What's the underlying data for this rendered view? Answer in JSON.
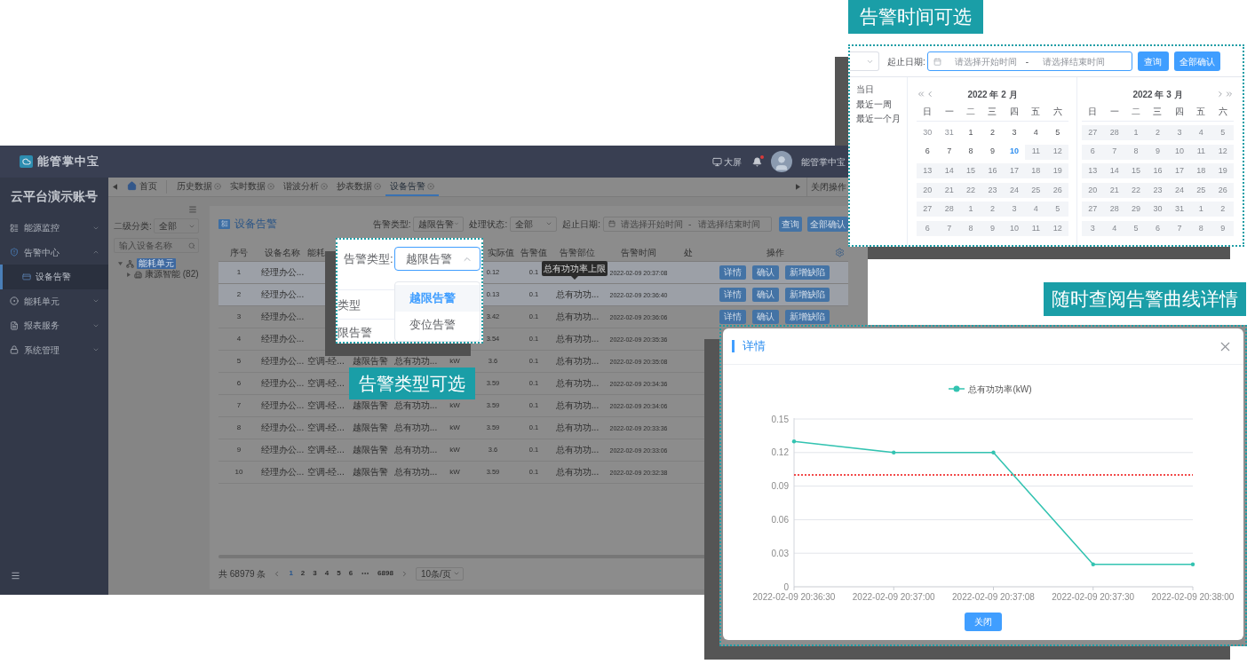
{
  "header": {
    "logo_text": "能管掌中宝",
    "screen_label": "大屏",
    "notification_unread": true,
    "user_name": "能管掌中宝"
  },
  "sidebar": {
    "account": "云平台演示账号",
    "items": [
      {
        "label": "能源监控",
        "expanded": false
      },
      {
        "label": "告警中心",
        "expanded": true,
        "children": [
          {
            "label": "设备告警",
            "selected": true
          }
        ]
      },
      {
        "label": "能耗单元",
        "expanded": false
      },
      {
        "label": "报表服务",
        "expanded": false
      },
      {
        "label": "系统管理",
        "expanded": false
      }
    ]
  },
  "tabs": [
    {
      "kind": "home",
      "label": "首页",
      "selected": false
    },
    {
      "kind": "page",
      "label": "历史数据",
      "selected": false
    },
    {
      "kind": "page",
      "label": "实时数据",
      "selected": false
    },
    {
      "kind": "page",
      "label": "谐波分析",
      "selected": false
    },
    {
      "kind": "page",
      "label": "抄表数据",
      "selected": false
    },
    {
      "kind": "page",
      "label": "设备告警",
      "selected": true
    }
  ],
  "tab_bar_action": "关闭操作",
  "tree_panel": {
    "category_label": "二级分类:",
    "category_value": "全部",
    "search_placeholder": "输入设备名称",
    "nodes": [
      {
        "label": "能耗单元",
        "selected": true,
        "expanded": true,
        "children": [
          {
            "label": "康源智能 (82)",
            "selected": false,
            "expanded": false
          }
        ]
      }
    ]
  },
  "alarm_panel": {
    "title": "设备告警",
    "filters": [
      {
        "label": "告警类型:",
        "value": "越限告警"
      },
      {
        "label": "处理状态:",
        "value": "全部"
      }
    ],
    "date_range": {
      "label": "起止日期:",
      "start_placeholder": "请选择开始时间",
      "separator": "-",
      "end_placeholder": "请选择结束时间"
    },
    "buttons": [
      "查询",
      "全部确认"
    ],
    "table": {
      "columns": {
        "index": "序号",
        "device_name": "设备名称",
        "column_3": "能耗",
        "actual_value": "实际值",
        "alarm_value": "告警值",
        "alarm_part": "告警部位",
        "alarm_time": "告警时间",
        "column_11": "处",
        "actions": "操作"
      },
      "rows": [
        {
          "index": "1",
          "device_name": "经理办公...",
          "actual_value": "0.12",
          "alarm_value": "0.1",
          "alarm_time": "2022-02-09 20:37:08",
          "highlighted": true,
          "actions": [
            "详情",
            "确认",
            "新增缺陷"
          ]
        },
        {
          "index": "2",
          "device_name": "经理办公...",
          "actual_value": "0.13",
          "alarm_value": "0.1",
          "alarm_part": "总有功功...",
          "alarm_time": "2022-02-09 20:36:40",
          "highlighted": true,
          "actions": [
            "详情",
            "确认",
            "新增缺陷"
          ]
        },
        {
          "index": "3",
          "device_name": "经理办公...",
          "actual_value": "3.42",
          "alarm_value": "0.1",
          "alarm_part": "总有功功...",
          "alarm_time": "2022-02-09 20:36:06",
          "highlighted": false,
          "actions": [
            "详情",
            "确认",
            "新增缺陷"
          ]
        },
        {
          "index": "4",
          "device_name": "经理办公...",
          "actual_value": "3.54",
          "alarm_value": "0.1",
          "alarm_part": "总有功功...",
          "alarm_time": "2022-02-09 20:35:36",
          "highlighted": false
        },
        {
          "index": "5",
          "device_name": "经理办公...",
          "column_3": "空调-经...",
          "column_4": "越限告警",
          "column_5": "总有功功...",
          "column_6": "kW",
          "actual_value": "3.6",
          "alarm_value": "0.1",
          "alarm_part": "总有功功...",
          "alarm_time": "2022-02-09 20:35:08",
          "highlighted": false
        },
        {
          "index": "6",
          "device_name": "经理办公...",
          "column_3": "空调-经...",
          "actual_value": "3.59",
          "alarm_value": "0.1",
          "alarm_part": "总有功功...",
          "alarm_time": "2022-02-09 20:34:36",
          "highlighted": false
        },
        {
          "index": "7",
          "device_name": "经理办公...",
          "column_3": "空调-经...",
          "column_4": "越限告警",
          "column_5": "总有功功...",
          "column_6": "kW",
          "actual_value": "3.59",
          "alarm_value": "0.1",
          "alarm_part": "总有功功...",
          "alarm_time": "2022-02-09 20:34:06",
          "highlighted": false
        },
        {
          "index": "8",
          "device_name": "经理办公...",
          "column_3": "空调-经...",
          "column_4": "越限告警",
          "column_5": "总有功功...",
          "column_6": "kW",
          "actual_value": "3.59",
          "alarm_value": "0.1",
          "alarm_part": "总有功功...",
          "alarm_time": "2022-02-09 20:33:36",
          "highlighted": false
        },
        {
          "index": "9",
          "device_name": "经理办公...",
          "column_3": "空调-经...",
          "column_4": "越限告警",
          "column_5": "总有功功...",
          "column_6": "kW",
          "actual_value": "3.6",
          "alarm_value": "0.1",
          "alarm_part": "总有功功...",
          "alarm_time": "2022-02-09 20:33:06",
          "highlighted": false
        },
        {
          "index": "10",
          "device_name": "经理办公...",
          "column_3": "空调-经...",
          "column_4": "越限告警",
          "column_5": "总有功功...",
          "column_6": "kW",
          "actual_value": "3.59",
          "alarm_value": "0.1",
          "alarm_part": "总有功功...",
          "alarm_time": "2022-02-09 20:32:38",
          "highlighted": false
        }
      ],
      "tooltip": "总有功功率上限"
    },
    "pagination": {
      "total": "共 68979 条",
      "pages": [
        {
          "kind": "page",
          "label": "1",
          "selected": true
        },
        {
          "kind": "page",
          "label": "2",
          "selected": false
        },
        {
          "kind": "page",
          "label": "3",
          "selected": false
        },
        {
          "kind": "page",
          "label": "4",
          "selected": false
        },
        {
          "kind": "page",
          "label": "5",
          "selected": false
        },
        {
          "kind": "page",
          "label": "6",
          "selected": false
        },
        {
          "kind": "more"
        },
        {
          "kind": "page",
          "label": "6898",
          "selected": false
        }
      ],
      "page_size": "10条/页"
    }
  },
  "alarm_type_callout": {
    "label": "告警类型:",
    "value": "越限告警",
    "expanded": true,
    "background_texts": [
      "类型",
      "限告警"
    ],
    "options": [
      {
        "label": "越限告警",
        "selected": true
      },
      {
        "label": "变位告警",
        "selected": false
      }
    ],
    "caption": "告警类型可选"
  },
  "date_callout": {
    "caption": "告警时间可选",
    "range_label": "起止日期:",
    "start_placeholder": "请选择开始时间",
    "separator": "-",
    "end_placeholder": "请选择结束时间",
    "buttons": [
      "查询",
      "全部确认"
    ],
    "shortcuts": [
      "当日",
      "最近一周",
      "最近一个月"
    ],
    "months": [
      {
        "kind": "prev",
        "title": "2022 年 2 月",
        "weekdays": [
          "日",
          "一",
          "二",
          "三",
          "四",
          "五",
          "六"
        ],
        "days": [
          {
            "day": "30",
            "kind": "other"
          },
          {
            "day": "31",
            "kind": "other"
          },
          {
            "day": "1",
            "kind": "normal"
          },
          {
            "day": "2",
            "kind": "normal"
          },
          {
            "day": "3",
            "kind": "normal"
          },
          {
            "day": "4",
            "kind": "normal"
          },
          {
            "day": "5",
            "kind": "normal"
          },
          {
            "day": "6",
            "kind": "normal"
          },
          {
            "day": "7",
            "kind": "normal"
          },
          {
            "day": "8",
            "kind": "normal"
          },
          {
            "day": "9",
            "kind": "normal"
          },
          {
            "day": "10",
            "kind": "today"
          },
          {
            "day": "11",
            "kind": "disabled"
          },
          {
            "day": "12",
            "kind": "disabled"
          },
          {
            "day": "13",
            "kind": "disabled"
          },
          {
            "day": "14",
            "kind": "disabled"
          },
          {
            "day": "15",
            "kind": "disabled"
          },
          {
            "day": "16",
            "kind": "disabled"
          },
          {
            "day": "17",
            "kind": "disabled"
          },
          {
            "day": "18",
            "kind": "disabled"
          },
          {
            "day": "19",
            "kind": "disabled"
          },
          {
            "day": "20",
            "kind": "disabled"
          },
          {
            "day": "21",
            "kind": "disabled"
          },
          {
            "day": "22",
            "kind": "disabled"
          },
          {
            "day": "23",
            "kind": "disabled"
          },
          {
            "day": "24",
            "kind": "disabled"
          },
          {
            "day": "25",
            "kind": "disabled"
          },
          {
            "day": "26",
            "kind": "disabled"
          },
          {
            "day": "27",
            "kind": "disabled"
          },
          {
            "day": "28",
            "kind": "disabled"
          },
          {
            "day": "1",
            "kind": "disabled"
          },
          {
            "day": "2",
            "kind": "disabled"
          },
          {
            "day": "3",
            "kind": "disabled"
          },
          {
            "day": "4",
            "kind": "disabled"
          },
          {
            "day": "5",
            "kind": "disabled"
          },
          {
            "day": "6",
            "kind": "disabled"
          },
          {
            "day": "7",
            "kind": "disabled"
          },
          {
            "day": "8",
            "kind": "disabled"
          },
          {
            "day": "9",
            "kind": "disabled"
          },
          {
            "day": "10",
            "kind": "disabled"
          },
          {
            "day": "11",
            "kind": "disabled"
          },
          {
            "day": "12",
            "kind": "disabled"
          }
        ]
      },
      {
        "kind": "next",
        "title": "2022 年 3 月",
        "weekdays": [
          "日",
          "一",
          "二",
          "三",
          "四",
          "五",
          "六"
        ],
        "days": [
          {
            "day": "27",
            "kind": "disabled"
          },
          {
            "day": "28",
            "kind": "disabled"
          },
          {
            "day": "1",
            "kind": "disabled"
          },
          {
            "day": "2",
            "kind": "disabled"
          },
          {
            "day": "3",
            "kind": "disabled"
          },
          {
            "day": "4",
            "kind": "disabled"
          },
          {
            "day": "5",
            "kind": "disabled"
          },
          {
            "day": "6",
            "kind": "disabled"
          },
          {
            "day": "7",
            "kind": "disabled"
          },
          {
            "day": "8",
            "kind": "disabled"
          },
          {
            "day": "9",
            "kind": "disabled"
          },
          {
            "day": "10",
            "kind": "disabled"
          },
          {
            "day": "11",
            "kind": "disabled"
          },
          {
            "day": "12",
            "kind": "disabled"
          },
          {
            "day": "13",
            "kind": "disabled"
          },
          {
            "day": "14",
            "kind": "disabled"
          },
          {
            "day": "15",
            "kind": "disabled"
          },
          {
            "day": "16",
            "kind": "disabled"
          },
          {
            "day": "17",
            "kind": "disabled"
          },
          {
            "day": "18",
            "kind": "disabled"
          },
          {
            "day": "19",
            "kind": "disabled"
          },
          {
            "day": "20",
            "kind": "disabled"
          },
          {
            "day": "21",
            "kind": "disabled"
          },
          {
            "day": "22",
            "kind": "disabled"
          },
          {
            "day": "23",
            "kind": "disabled"
          },
          {
            "day": "24",
            "kind": "disabled"
          },
          {
            "day": "25",
            "kind": "disabled"
          },
          {
            "day": "26",
            "kind": "disabled"
          },
          {
            "day": "27",
            "kind": "disabled"
          },
          {
            "day": "28",
            "kind": "disabled"
          },
          {
            "day": "29",
            "kind": "disabled"
          },
          {
            "day": "30",
            "kind": "disabled"
          },
          {
            "day": "31",
            "kind": "disabled"
          },
          {
            "day": "1",
            "kind": "disabled"
          },
          {
            "day": "2",
            "kind": "disabled"
          },
          {
            "day": "3",
            "kind": "disabled"
          },
          {
            "day": "4",
            "kind": "disabled"
          },
          {
            "day": "5",
            "kind": "disabled"
          },
          {
            "day": "6",
            "kind": "disabled"
          },
          {
            "day": "7",
            "kind": "disabled"
          },
          {
            "day": "8",
            "kind": "disabled"
          },
          {
            "day": "9",
            "kind": "disabled"
          }
        ]
      }
    ]
  },
  "detail_dialog": {
    "title": "详情",
    "chart_data": {
      "type": "line",
      "categories": [
        "2022-02-09 20:36:30",
        "2022-02-09 20:37:00",
        "2022-02-09 20:37:08",
        "2022-02-09 20:37:30",
        "2022-02-09 20:38:00"
      ],
      "series": [
        {
          "name": "总有功功率(kW)",
          "color": "#33c3b1",
          "values": [
            0.13,
            0.12,
            0.12,
            0.02,
            0.02
          ]
        }
      ],
      "ylim": [
        0,
        0.15
      ],
      "yticks": [
        0,
        0.03,
        0.06,
        0.09,
        0.12,
        0.15
      ],
      "grid": true,
      "ref_lines": [
        {
          "axis": "y",
          "value": 0.1,
          "color": "#ee1111"
        }
      ]
    },
    "close_button": "关闭",
    "caption": "随时查阅告警曲线详情"
  }
}
